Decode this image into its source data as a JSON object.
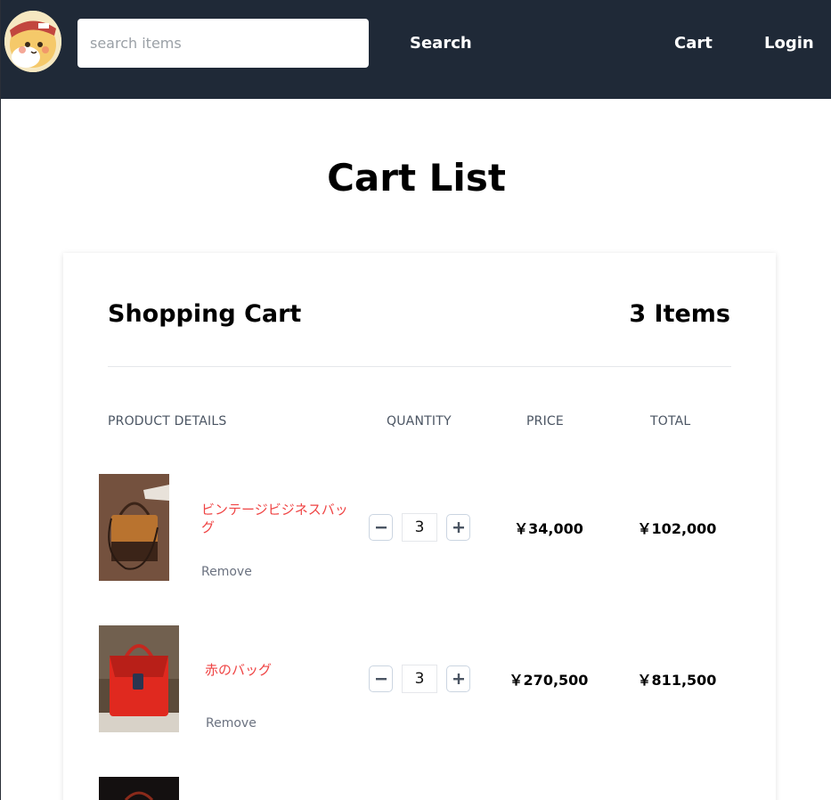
{
  "header": {
    "search_placeholder": "search items",
    "search_label": "Search",
    "cart_label": "Cart",
    "login_label": "Login"
  },
  "page": {
    "title": "Cart List"
  },
  "cart": {
    "heading": "Shopping Cart",
    "item_count": "3 Items",
    "columns": [
      "PRODUCT DETAILS",
      "QUANTITY",
      "PRICE",
      "TOTAL"
    ],
    "items": [
      {
        "name": "ビンテージビジネスバッグ",
        "remove_label": "Remove",
        "quantity": "3",
        "price": "￥34,000",
        "total": "￥102,000"
      },
      {
        "name": "赤のバッグ",
        "remove_label": "Remove",
        "quantity": "3",
        "price": "￥270,500",
        "total": "￥811,500"
      }
    ]
  },
  "colors": {
    "navbar": "#1f2937",
    "product_link": "#ef4444",
    "muted_text": "#6b7280"
  }
}
